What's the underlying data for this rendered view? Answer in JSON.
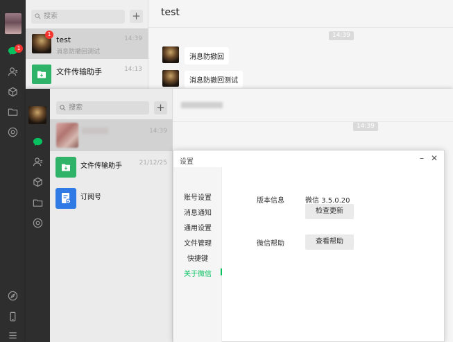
{
  "back_window": {
    "search_placeholder": "搜索",
    "unread_badge": "1",
    "conversations": [
      {
        "name": "test",
        "preview": "消息防撤回测试",
        "time": "14:39",
        "badge": "1"
      },
      {
        "name": "文件传输助手",
        "preview": "",
        "time": "14:13"
      }
    ],
    "chat": {
      "title": "test",
      "timestamp": "14:39",
      "messages": [
        "消息防撤回",
        "消息防撤回测试"
      ]
    }
  },
  "front_window": {
    "search_placeholder": "搜索",
    "conversations": [
      {
        "name": "",
        "time": "14:39"
      },
      {
        "name": "文件传输助手",
        "time": "21/12/25"
      },
      {
        "name": "订阅号",
        "time": ""
      }
    ],
    "chat": {
      "timestamp": "14:39"
    }
  },
  "settings": {
    "title": "设置",
    "nav": [
      "账号设置",
      "消息通知",
      "通用设置",
      "文件管理",
      "快捷键",
      "关于微信"
    ],
    "active_nav": "关于微信",
    "version_label": "版本信息",
    "version_value": "微信 3.5.0.20",
    "check_update_button": "检查更新",
    "help_label": "微信帮助",
    "view_help_button": "查看帮助"
  },
  "colors": {
    "accent": "#07c160",
    "rail": "#2e2e2e",
    "badge": "#f43530"
  }
}
